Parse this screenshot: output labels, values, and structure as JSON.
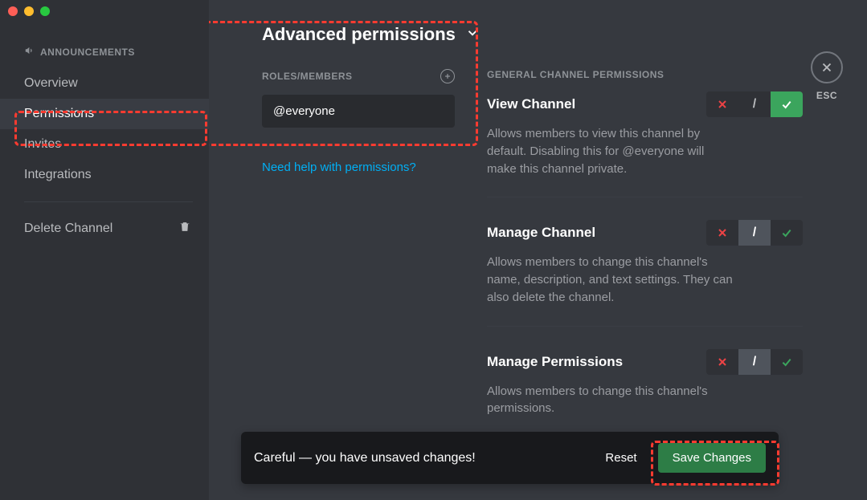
{
  "sidebar": {
    "header": "ANNOUNCEMENTS",
    "items": [
      {
        "label": "Overview",
        "active": false
      },
      {
        "label": "Permissions",
        "active": true
      },
      {
        "label": "Invites",
        "active": false
      },
      {
        "label": "Integrations",
        "active": false
      }
    ],
    "delete_label": "Delete Channel"
  },
  "page": {
    "title": "Advanced permissions"
  },
  "roles": {
    "section_label": "ROLES/MEMBERS",
    "selected": "@everyone",
    "help_link": "Need help with permissions?"
  },
  "permissions": {
    "section_label": "GENERAL CHANNEL PERMISSIONS",
    "items": [
      {
        "title": "View Channel",
        "desc": "Allows members to view this channel by default. Disabling this for @everyone will make this channel private.",
        "state": "allow"
      },
      {
        "title": "Manage Channel",
        "desc": "Allows members to change this channel's name, description, and text settings. They can also delete the channel.",
        "state": "neutral"
      },
      {
        "title": "Manage Permissions",
        "desc": "Allows members to change this channel's permissions.",
        "state": "neutral"
      }
    ]
  },
  "close": {
    "esc": "ESC"
  },
  "unsaved": {
    "message": "Careful — you have unsaved changes!",
    "reset": "Reset",
    "save": "Save Changes"
  },
  "colors": {
    "accent_green": "#3ba55d",
    "accent_red": "#ed4245",
    "link_blue": "#00aff4",
    "annotation_red": "#ff3b30"
  }
}
